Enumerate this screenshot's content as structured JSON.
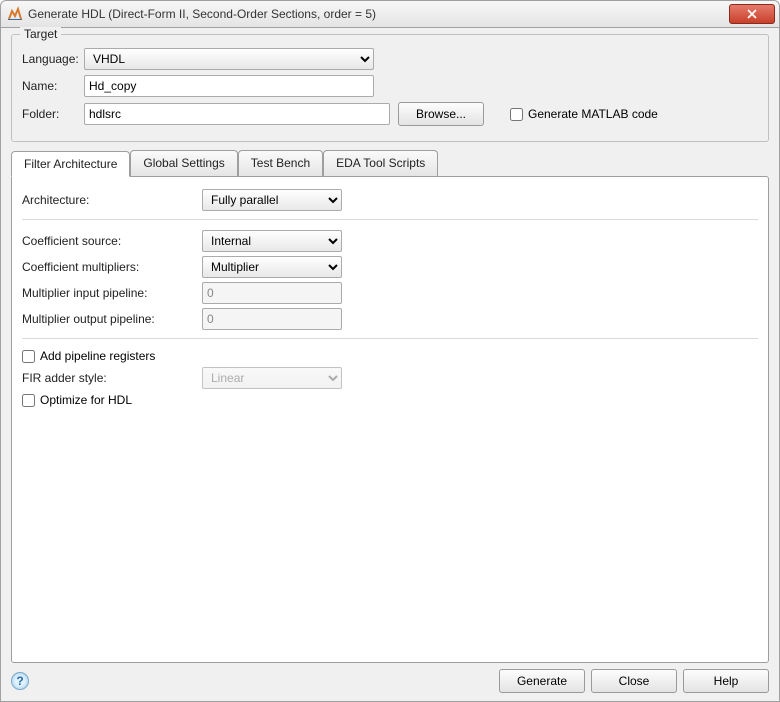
{
  "window": {
    "title": "Generate HDL (Direct-Form II, Second-Order Sections, order = 5)"
  },
  "target": {
    "legend": "Target",
    "language_label": "Language:",
    "language_value": "VHDL",
    "name_label": "Name:",
    "name_value": "Hd_copy",
    "folder_label": "Folder:",
    "folder_value": "hdlsrc",
    "browse_label": "Browse...",
    "gen_matlab_label": "Generate MATLAB code"
  },
  "tabs": {
    "filter_arch": "Filter Architecture",
    "global": "Global Settings",
    "test_bench": "Test Bench",
    "eda": "EDA Tool Scripts"
  },
  "arch": {
    "architecture_label": "Architecture:",
    "architecture_value": "Fully parallel",
    "coef_source_label": "Coefficient source:",
    "coef_source_value": "Internal",
    "coef_mult_label": "Coefficient multipliers:",
    "coef_mult_value": "Multiplier",
    "mult_in_label": "Multiplier input pipeline:",
    "mult_in_value": "0",
    "mult_out_label": "Multiplier output pipeline:",
    "mult_out_value": "0",
    "add_pipeline_label": "Add pipeline registers",
    "fir_adder_label": "FIR adder style:",
    "fir_adder_value": "Linear",
    "optimize_label": "Optimize for HDL"
  },
  "footer": {
    "generate": "Generate",
    "close": "Close",
    "help": "Help"
  }
}
